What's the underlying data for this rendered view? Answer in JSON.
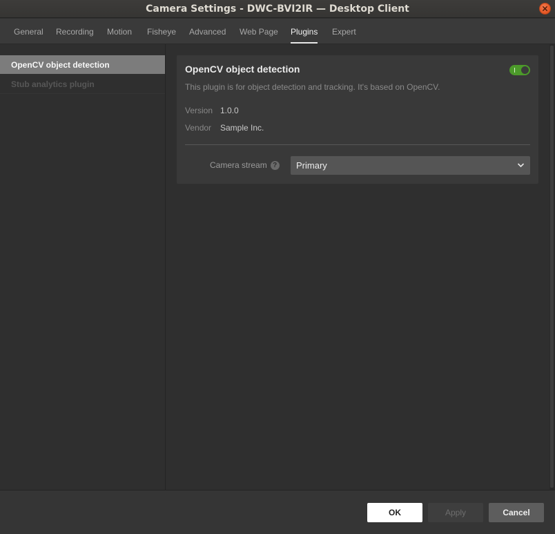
{
  "window": {
    "title": "Camera Settings - DWC-BVI2IR — Desktop Client"
  },
  "tabs": [
    {
      "label": "General"
    },
    {
      "label": "Recording"
    },
    {
      "label": "Motion"
    },
    {
      "label": "Fisheye"
    },
    {
      "label": "Advanced"
    },
    {
      "label": "Web Page"
    },
    {
      "label": "Plugins",
      "active": true
    },
    {
      "label": "Expert"
    }
  ],
  "sidebar": {
    "items": [
      {
        "label": "OpenCV object detection",
        "active": true
      },
      {
        "label": "Stub analytics plugin",
        "active": false
      }
    ]
  },
  "plugin": {
    "name": "OpenCV object detection",
    "enabled": true,
    "description": "This plugin is for object detection and tracking. It's based on OpenCV.",
    "version_label": "Version",
    "version_value": "1.0.0",
    "vendor_label": "Vendor",
    "vendor_value": "Sample Inc.",
    "camera_stream_label": "Camera stream",
    "help_glyph": "?",
    "camera_stream_value": "Primary"
  },
  "buttons": {
    "ok": "OK",
    "apply": "Apply",
    "cancel": "Cancel"
  },
  "colors": {
    "toggle_on": "#4c9a2a",
    "close_button": "#e35522",
    "active_sidebar": "#7c7c7c"
  }
}
